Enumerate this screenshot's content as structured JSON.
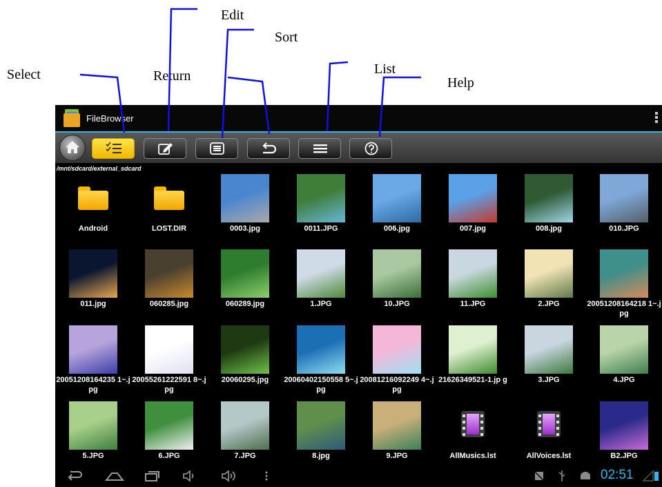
{
  "annotations": {
    "select": "Select",
    "return": "Return",
    "edit": "Edit",
    "sort": "Sort",
    "list": "List",
    "help": "Help"
  },
  "app": {
    "title": "FileBrowser",
    "path": "/mnt/sdcard/external_sdcard"
  },
  "toolbar": [
    {
      "name": "select-button",
      "icon": "select-checklist-icon",
      "active": true
    },
    {
      "name": "edit-button",
      "icon": "edit-pencil-icon",
      "active": false
    },
    {
      "name": "sort-button",
      "icon": "sort-list-icon",
      "active": false
    },
    {
      "name": "return-button",
      "icon": "return-arrow-icon",
      "active": false
    },
    {
      "name": "list-button",
      "icon": "list-menu-icon",
      "active": false
    },
    {
      "name": "help-button",
      "icon": "help-question-icon",
      "active": false
    }
  ],
  "files": [
    {
      "label": "Android",
      "kind": "folder"
    },
    {
      "label": "LOST.DIR",
      "kind": "folder"
    },
    {
      "label": "0003.jpg",
      "kind": "image",
      "colors": [
        "#4a86cf",
        "#a9a9a9"
      ]
    },
    {
      "label": "0011.JPG",
      "kind": "image",
      "colors": [
        "#3f7d3a",
        "#66b6d9"
      ]
    },
    {
      "label": "006.jpg",
      "kind": "image",
      "colors": [
        "#6aa8e6",
        "#2d6aa5"
      ]
    },
    {
      "label": "007.jpg",
      "kind": "image",
      "colors": [
        "#5aa1e8",
        "#c23a2f"
      ]
    },
    {
      "label": "008.jpg",
      "kind": "image",
      "colors": [
        "#2f5a34",
        "#9fd6e8"
      ]
    },
    {
      "label": "010.JPG",
      "kind": "image",
      "colors": [
        "#7fa7d8",
        "#54606b"
      ]
    },
    {
      "label": "011.jpg",
      "kind": "image",
      "colors": [
        "#0a1630",
        "#e8a64f"
      ]
    },
    {
      "label": "060285.jpg",
      "kind": "image",
      "colors": [
        "#4a4030",
        "#c98a2e"
      ]
    },
    {
      "label": "060289.jpg",
      "kind": "image",
      "colors": [
        "#2e7d2e",
        "#8ccf6a"
      ]
    },
    {
      "label": "1.JPG",
      "kind": "image",
      "colors": [
        "#d0dbe8",
        "#4f8a3a"
      ]
    },
    {
      "label": "10.JPG",
      "kind": "image",
      "colors": [
        "#a9c7a0",
        "#3a6f3a"
      ]
    },
    {
      "label": "11.JPG",
      "kind": "image",
      "colors": [
        "#c9d8e0",
        "#3f8f2f"
      ]
    },
    {
      "label": "2.JPG",
      "kind": "image",
      "colors": [
        "#f2e3b5",
        "#5f7a4a"
      ]
    },
    {
      "label": "20051208164218 1~.jpg",
      "kind": "image",
      "colors": [
        "#3f8f8a",
        "#d68a5a"
      ]
    },
    {
      "label": "20051208164235 1~.jpg",
      "kind": "image",
      "colors": [
        "#b8a4dc",
        "#3b3fa8"
      ]
    },
    {
      "label": "20055261222591 8~.jpg",
      "kind": "image",
      "colors": [
        "#ffffff",
        "#e0e0f0"
      ]
    },
    {
      "label": "20060295.jpg",
      "kind": "image",
      "colors": [
        "#1f3a12",
        "#6ec24a"
      ]
    },
    {
      "label": "20060402150558 5~.jpg",
      "kind": "image",
      "colors": [
        "#1b6fb5",
        "#8fdcf0"
      ]
    },
    {
      "label": "20081216092249 4~.jpg",
      "kind": "image",
      "colors": [
        "#f4b7d8",
        "#9ee0f2"
      ]
    },
    {
      "label": "21626349521-1.jp g",
      "kind": "image",
      "colors": [
        "#dff0d0",
        "#3f8a2f"
      ]
    },
    {
      "label": "3.JPG",
      "kind": "image",
      "colors": [
        "#c9d6e0",
        "#3d7a3d"
      ]
    },
    {
      "label": "4.JPG",
      "kind": "image",
      "colors": [
        "#b8d4a8",
        "#3f7f52"
      ]
    },
    {
      "label": "5.JPG",
      "kind": "image",
      "colors": [
        "#a8d08a",
        "#3f7f3f"
      ]
    },
    {
      "label": "6.JPG",
      "kind": "image",
      "colors": [
        "#3f8f3f",
        "#f0f0f0"
      ]
    },
    {
      "label": "7.JPG",
      "kind": "image",
      "colors": [
        "#b5c8c8",
        "#4f6f4f"
      ]
    },
    {
      "label": "8.jpg",
      "kind": "image",
      "colors": [
        "#5f8f4a",
        "#2f5a7a"
      ]
    },
    {
      "label": "9.JPG",
      "kind": "image",
      "colors": [
        "#c9b07a",
        "#3f7f5a"
      ]
    },
    {
      "label": "AllMusics.lst",
      "kind": "list-file"
    },
    {
      "label": "AllVoices.lst",
      "kind": "list-file"
    },
    {
      "label": "B2.JPG",
      "kind": "image",
      "colors": [
        "#2a2a8a",
        "#c96ad8"
      ]
    }
  ],
  "status": {
    "clock": "02:51"
  },
  "colors": {
    "accent": "#35b5e5",
    "active_button": "#f7c600"
  }
}
